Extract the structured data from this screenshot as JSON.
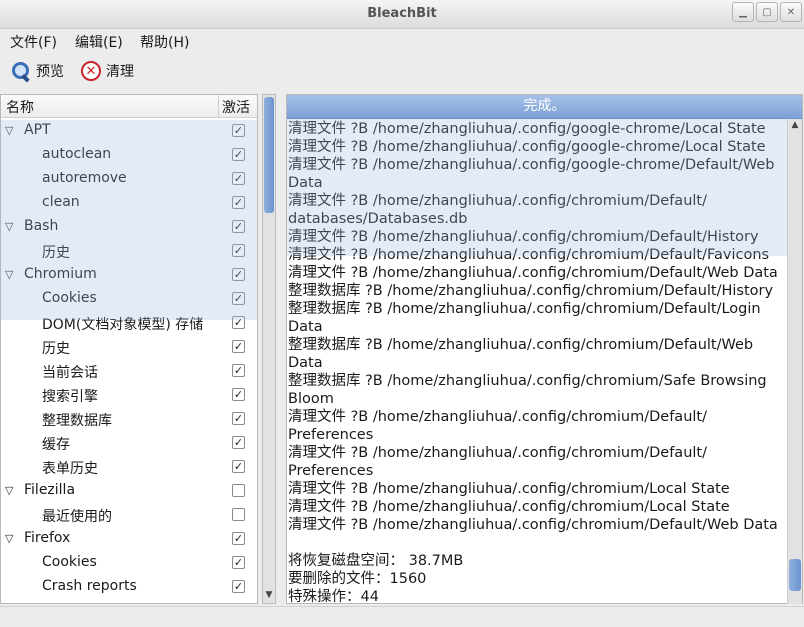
{
  "window": {
    "title": "BleachBit",
    "min": "▁",
    "max": "▢",
    "close": "✕"
  },
  "menu": [
    "文件(F)",
    "编辑(E)",
    "帮助(H)"
  ],
  "toolbar": {
    "preview_label": "预览",
    "clean_label": "清理",
    "preview_icon": "search-icon",
    "clean_icon": "clean-icon"
  },
  "tree": {
    "col_name": "名称",
    "col_active": "激活",
    "rows": [
      {
        "label": "APT",
        "level": 0,
        "checked": true
      },
      {
        "label": "autoclean",
        "level": 1,
        "checked": true
      },
      {
        "label": "autoremove",
        "level": 1,
        "checked": true
      },
      {
        "label": "clean",
        "level": 1,
        "checked": true
      },
      {
        "label": "Bash",
        "level": 0,
        "checked": true
      },
      {
        "label": "历史",
        "level": 1,
        "checked": true
      },
      {
        "label": "Chromium",
        "level": 0,
        "checked": true
      },
      {
        "label": "Cookies",
        "level": 1,
        "checked": true
      },
      {
        "label": "DOM(文档对象模型) 存储",
        "level": 1,
        "checked": true
      },
      {
        "label": "历史",
        "level": 1,
        "checked": true
      },
      {
        "label": "当前会话",
        "level": 1,
        "checked": true
      },
      {
        "label": "搜索引擎",
        "level": 1,
        "checked": true
      },
      {
        "label": "整理数据库",
        "level": 1,
        "checked": true
      },
      {
        "label": "缓存",
        "level": 1,
        "checked": true
      },
      {
        "label": "表单历史",
        "level": 1,
        "checked": true
      },
      {
        "label": "Filezilla",
        "level": 0,
        "checked": false
      },
      {
        "label": "最近使用的",
        "level": 1,
        "checked": false
      },
      {
        "label": "Firefox",
        "level": 0,
        "checked": true
      },
      {
        "label": "Cookies",
        "level": 1,
        "checked": true
      },
      {
        "label": "Crash reports",
        "level": 1,
        "checked": true
      }
    ]
  },
  "progress_text": "完成。",
  "log_lines": [
    "清理文件 ?B /home/zhangliuhua/.config/google-chrome/Local State",
    "清理文件 ?B /home/zhangliuhua/.config/google-chrome/Local State",
    "清理文件 ?B /home/zhangliuhua/.config/google-chrome/Default/Web",
    "Data",
    "清理文件 ?B /home/zhangliuhua/.config/chromium/Default/",
    "databases/Databases.db",
    "清理文件 ?B /home/zhangliuhua/.config/chromium/Default/History",
    "清理文件 ?B /home/zhangliuhua/.config/chromium/Default/Favicons",
    "清理文件 ?B /home/zhangliuhua/.config/chromium/Default/Web Data",
    "整理数据库 ?B /home/zhangliuhua/.config/chromium/Default/History",
    "整理数据库 ?B /home/zhangliuhua/.config/chromium/Default/Login",
    "Data",
    "整理数据库 ?B /home/zhangliuhua/.config/chromium/Default/Web",
    "Data",
    "整理数据库 ?B /home/zhangliuhua/.config/chromium/Safe Browsing",
    "Bloom",
    "清理文件 ?B /home/zhangliuhua/.config/chromium/Default/",
    "Preferences",
    "清理文件 ?B /home/zhangliuhua/.config/chromium/Default/",
    "Preferences",
    "清理文件 ?B /home/zhangliuhua/.config/chromium/Local State",
    "清理文件 ?B /home/zhangliuhua/.config/chromium/Local State",
    "清理文件 ?B /home/zhangliuhua/.config/chromium/Default/Web Data",
    "",
    "将恢复磁盘空间： 38.7MB",
    "要删除的文件：1560",
    "特殊操作：44"
  ]
}
